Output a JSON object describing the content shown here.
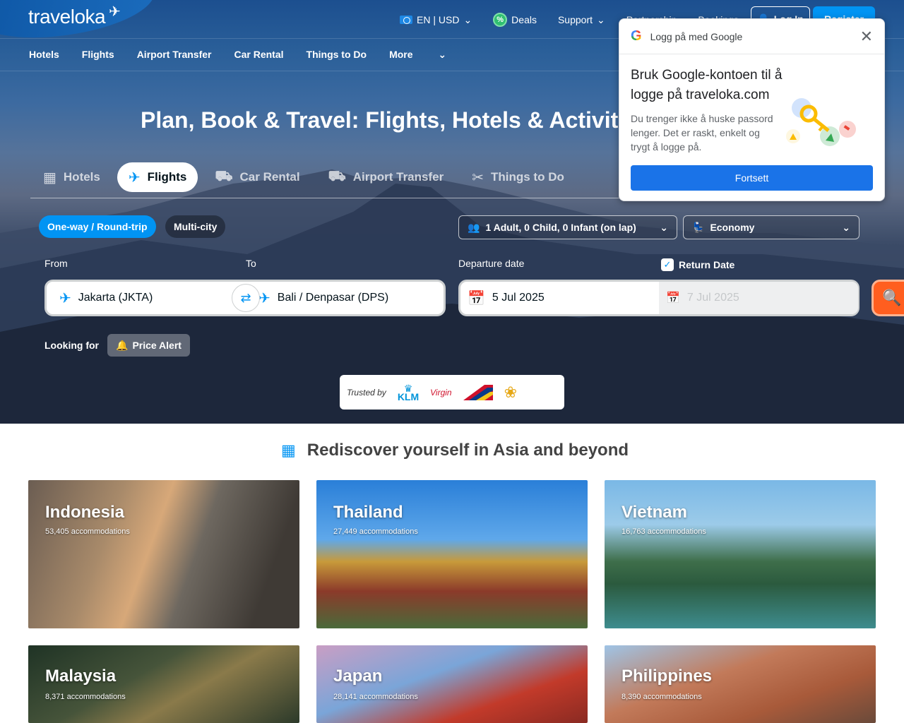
{
  "brand": {
    "name": "traveloka"
  },
  "topnav": {
    "lang": "EN | USD",
    "deals": "Deals",
    "support": "Support",
    "partnership": "Partnership",
    "bookings": "Bookings",
    "login": "Log In",
    "register": "Register"
  },
  "subnav": [
    "Hotels",
    "Flights",
    "Airport Transfer",
    "Car Rental",
    "Things to Do",
    "More"
  ],
  "hero": {
    "headline": "Plan, Book & Travel: Flights, Hotels & Activities"
  },
  "tabs": [
    "Hotels",
    "Flights",
    "Car Rental",
    "Airport Transfer",
    "Things to Do"
  ],
  "active_tab": "Flights",
  "trip_type": {
    "oneway": "One-way / Round-trip",
    "multicity": "Multi-city"
  },
  "passengers": "1 Adult, 0 Child, 0 Infant (on lap)",
  "seat_class": "Economy",
  "form": {
    "from_label": "From",
    "to_label": "To",
    "from_value": "Jakarta (JKTA)",
    "to_value": "Bali / Denpasar (DPS)",
    "departure_label": "Departure date",
    "return_label": "Return Date",
    "departure_value": "5 Jul 2025",
    "return_value": "7 Jul 2025"
  },
  "looking_for": "Looking for",
  "price_alert": "Price Alert",
  "trusted_by": "Trusted by",
  "airlines": [
    "KLM",
    "Virgin",
    "Philippine Airlines",
    "Vietnam Airlines"
  ],
  "google_popup": {
    "header": "Logg på med Google",
    "title": "Bruk Google-kontoen til å logge på traveloka.com",
    "desc": "Du trenger ikke å huske passord lenger. Det er raskt, enkelt og trygt å logge på.",
    "button": "Fortsett"
  },
  "section": {
    "title": "Rediscover yourself in Asia and beyond"
  },
  "destinations": [
    {
      "name": "Indonesia",
      "count": "53,405 accommodations"
    },
    {
      "name": "Thailand",
      "count": "27,449 accommodations"
    },
    {
      "name": "Vietnam",
      "count": "16,763 accommodations"
    },
    {
      "name": "Malaysia",
      "count": "8,371 accommodations"
    },
    {
      "name": "Japan",
      "count": "28,141 accommodations"
    },
    {
      "name": "Philippines",
      "count": "8,390 accommodations"
    }
  ],
  "colors": {
    "primary": "#0194f3",
    "search": "#ff5e1f",
    "google_btn": "#1a73e8"
  }
}
